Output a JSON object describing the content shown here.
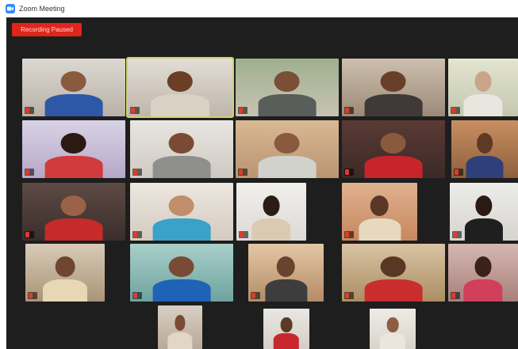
{
  "window": {
    "title": "Zoom Meeting",
    "icon": "zoom-camera-icon"
  },
  "toolbar": {
    "recording_label": "Recording Paused"
  },
  "colors": {
    "stage": "#1e1e1e",
    "recording": "#e0251b",
    "active_speaker": "#cfd46a",
    "muted_mic": "#e03a2e"
  },
  "participants": [
    {
      "name": ""
    },
    {
      "name": ""
    },
    {
      "name": ""
    },
    {
      "name": ""
    },
    {
      "name": ""
    },
    {
      "name": ""
    },
    {
      "name": ""
    },
    {
      "name": ""
    },
    {
      "name": ""
    },
    {
      "name": ""
    },
    {
      "name": ""
    },
    {
      "name": ""
    },
    {
      "name": ""
    },
    {
      "name": ""
    },
    {
      "name": ""
    },
    {
      "name": ""
    },
    {
      "name": ""
    },
    {
      "name": ""
    },
    {
      "name": ""
    },
    {
      "name": ""
    },
    {
      "name": ""
    },
    {
      "name": ""
    },
    {
      "name": ""
    }
  ]
}
